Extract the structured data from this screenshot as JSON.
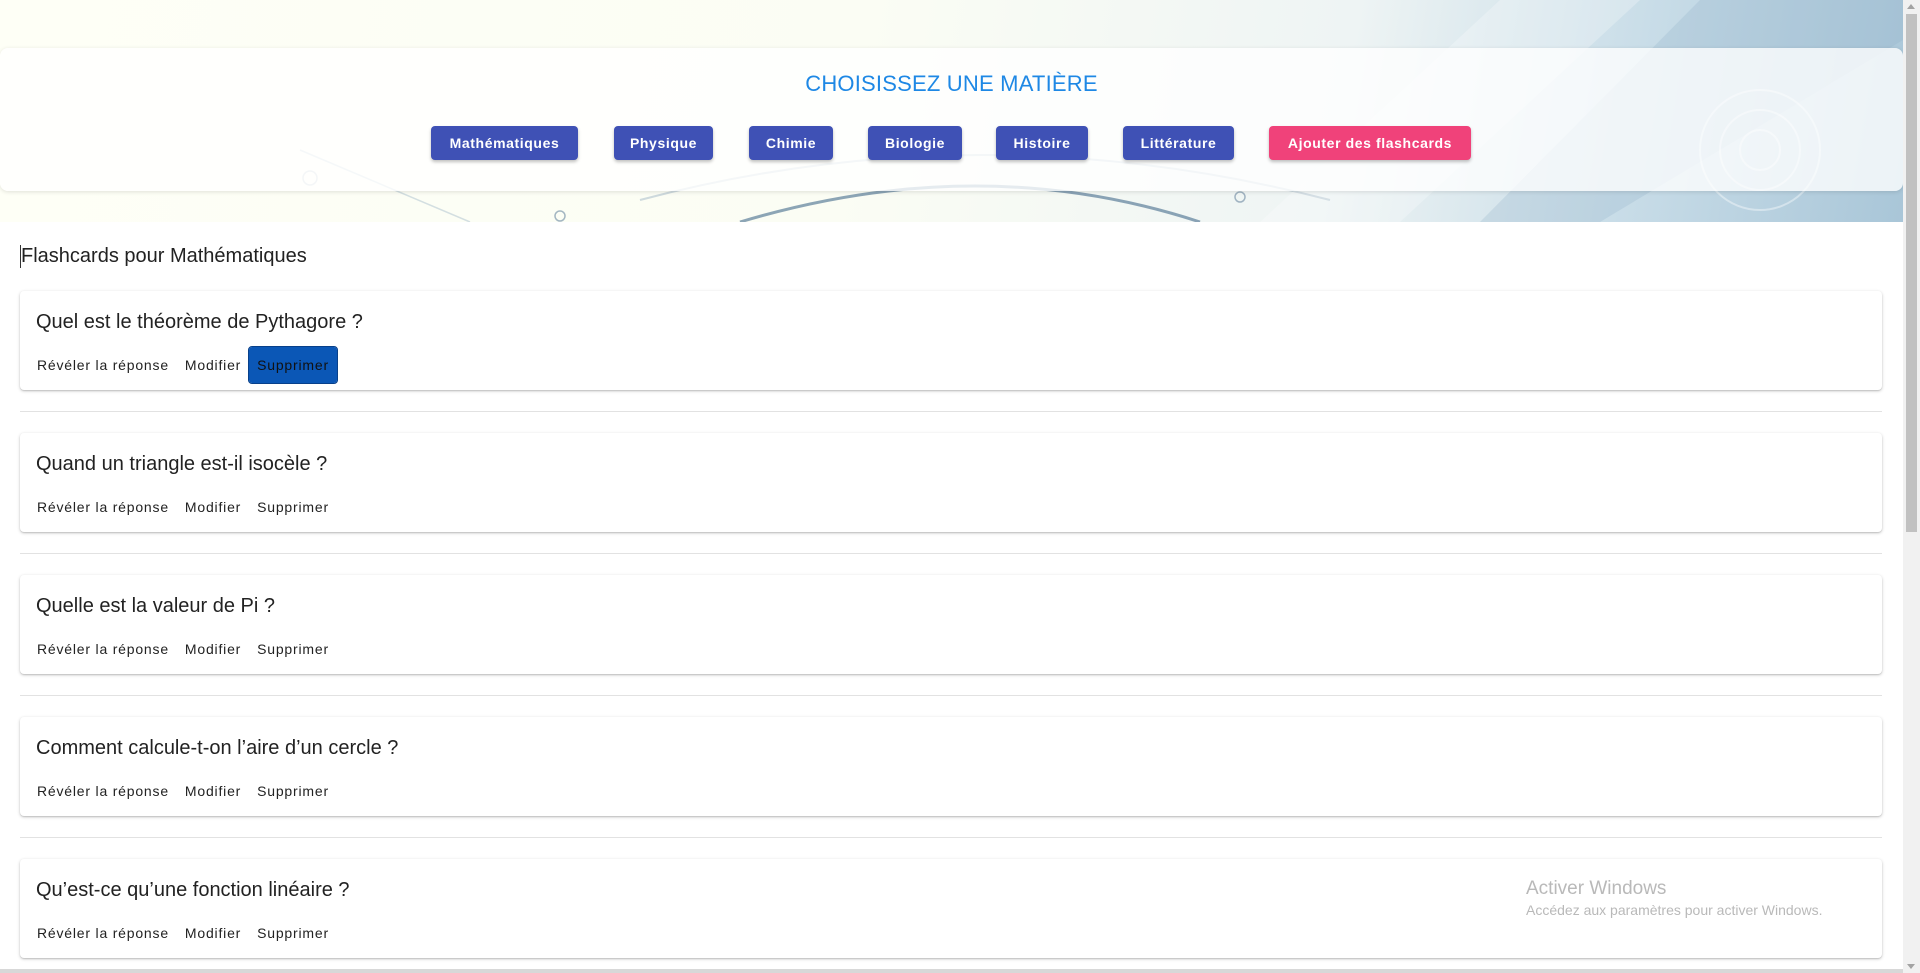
{
  "header": {
    "title": "CHOISISSEZ UNE MATIÈRE",
    "subjects": [
      {
        "label": "Mathématiques"
      },
      {
        "label": "Physique"
      },
      {
        "label": "Chimie"
      },
      {
        "label": "Biologie"
      },
      {
        "label": "Histoire"
      },
      {
        "label": "Littérature"
      }
    ],
    "add_label": "Ajouter des flashcards"
  },
  "main": {
    "section_title": "Flashcards pour Mathématiques",
    "cards": [
      {
        "question": "Quel est le théorème de Pythagore ?",
        "reveal": "Révéler la réponse",
        "edit": "Modifier",
        "delete": "Supprimer"
      },
      {
        "question": "Quand un triangle est-il isocèle ?",
        "reveal": "Révéler la réponse",
        "edit": "Modifier",
        "delete": "Supprimer"
      },
      {
        "question": "Quelle est la valeur de Pi ?",
        "reveal": "Révéler la réponse",
        "edit": "Modifier",
        "delete": "Supprimer"
      },
      {
        "question": "Comment calcule-t-on l’aire d’un cercle ?",
        "reveal": "Révéler la réponse",
        "edit": "Modifier",
        "delete": "Supprimer"
      },
      {
        "question": "Qu’est-ce qu’une fonction linéaire ?",
        "reveal": "Révéler la réponse",
        "edit": "Modifier",
        "delete": "Supprimer"
      }
    ]
  },
  "watermark": {
    "title": "Activer Windows",
    "subtitle": "Accédez aux paramètres pour activer Windows."
  },
  "colors": {
    "header_title": "#1e88e5",
    "subject_button": "#3f51b5",
    "add_button": "#f0427a",
    "focused_button": "#0b57b6"
  }
}
